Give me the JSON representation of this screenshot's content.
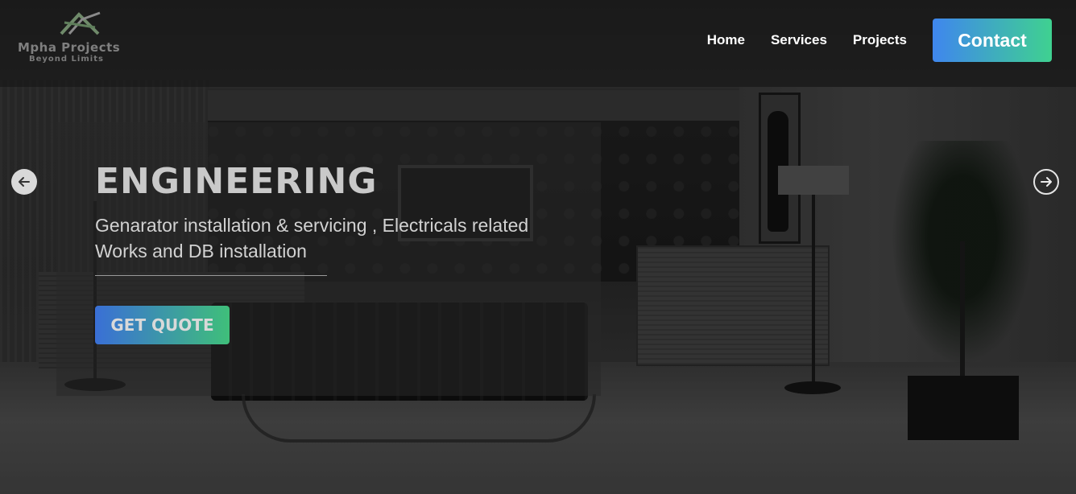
{
  "brand": {
    "name": "Mpha Projects",
    "tagline": "Beyond Limits",
    "logo_icon": "house-roof-logo-icon"
  },
  "nav": {
    "items": [
      {
        "label": "Home"
      },
      {
        "label": "Services"
      },
      {
        "label": "Projects"
      }
    ],
    "contact_label": "Contact"
  },
  "hero": {
    "title": "ENGINEERING",
    "description_line1": "Genarator installation & servicing , Electricals related",
    "description_line2": "Works and DB installation",
    "cta_label": "GET QUOTE",
    "prev_icon": "arrow-left-circle-icon",
    "next_icon": "arrow-right-circle-icon"
  },
  "colors": {
    "accent_start": "#3f86ee",
    "accent_end": "#3fd190",
    "header_bg": "#191919",
    "nav_text": "#ffffff"
  }
}
